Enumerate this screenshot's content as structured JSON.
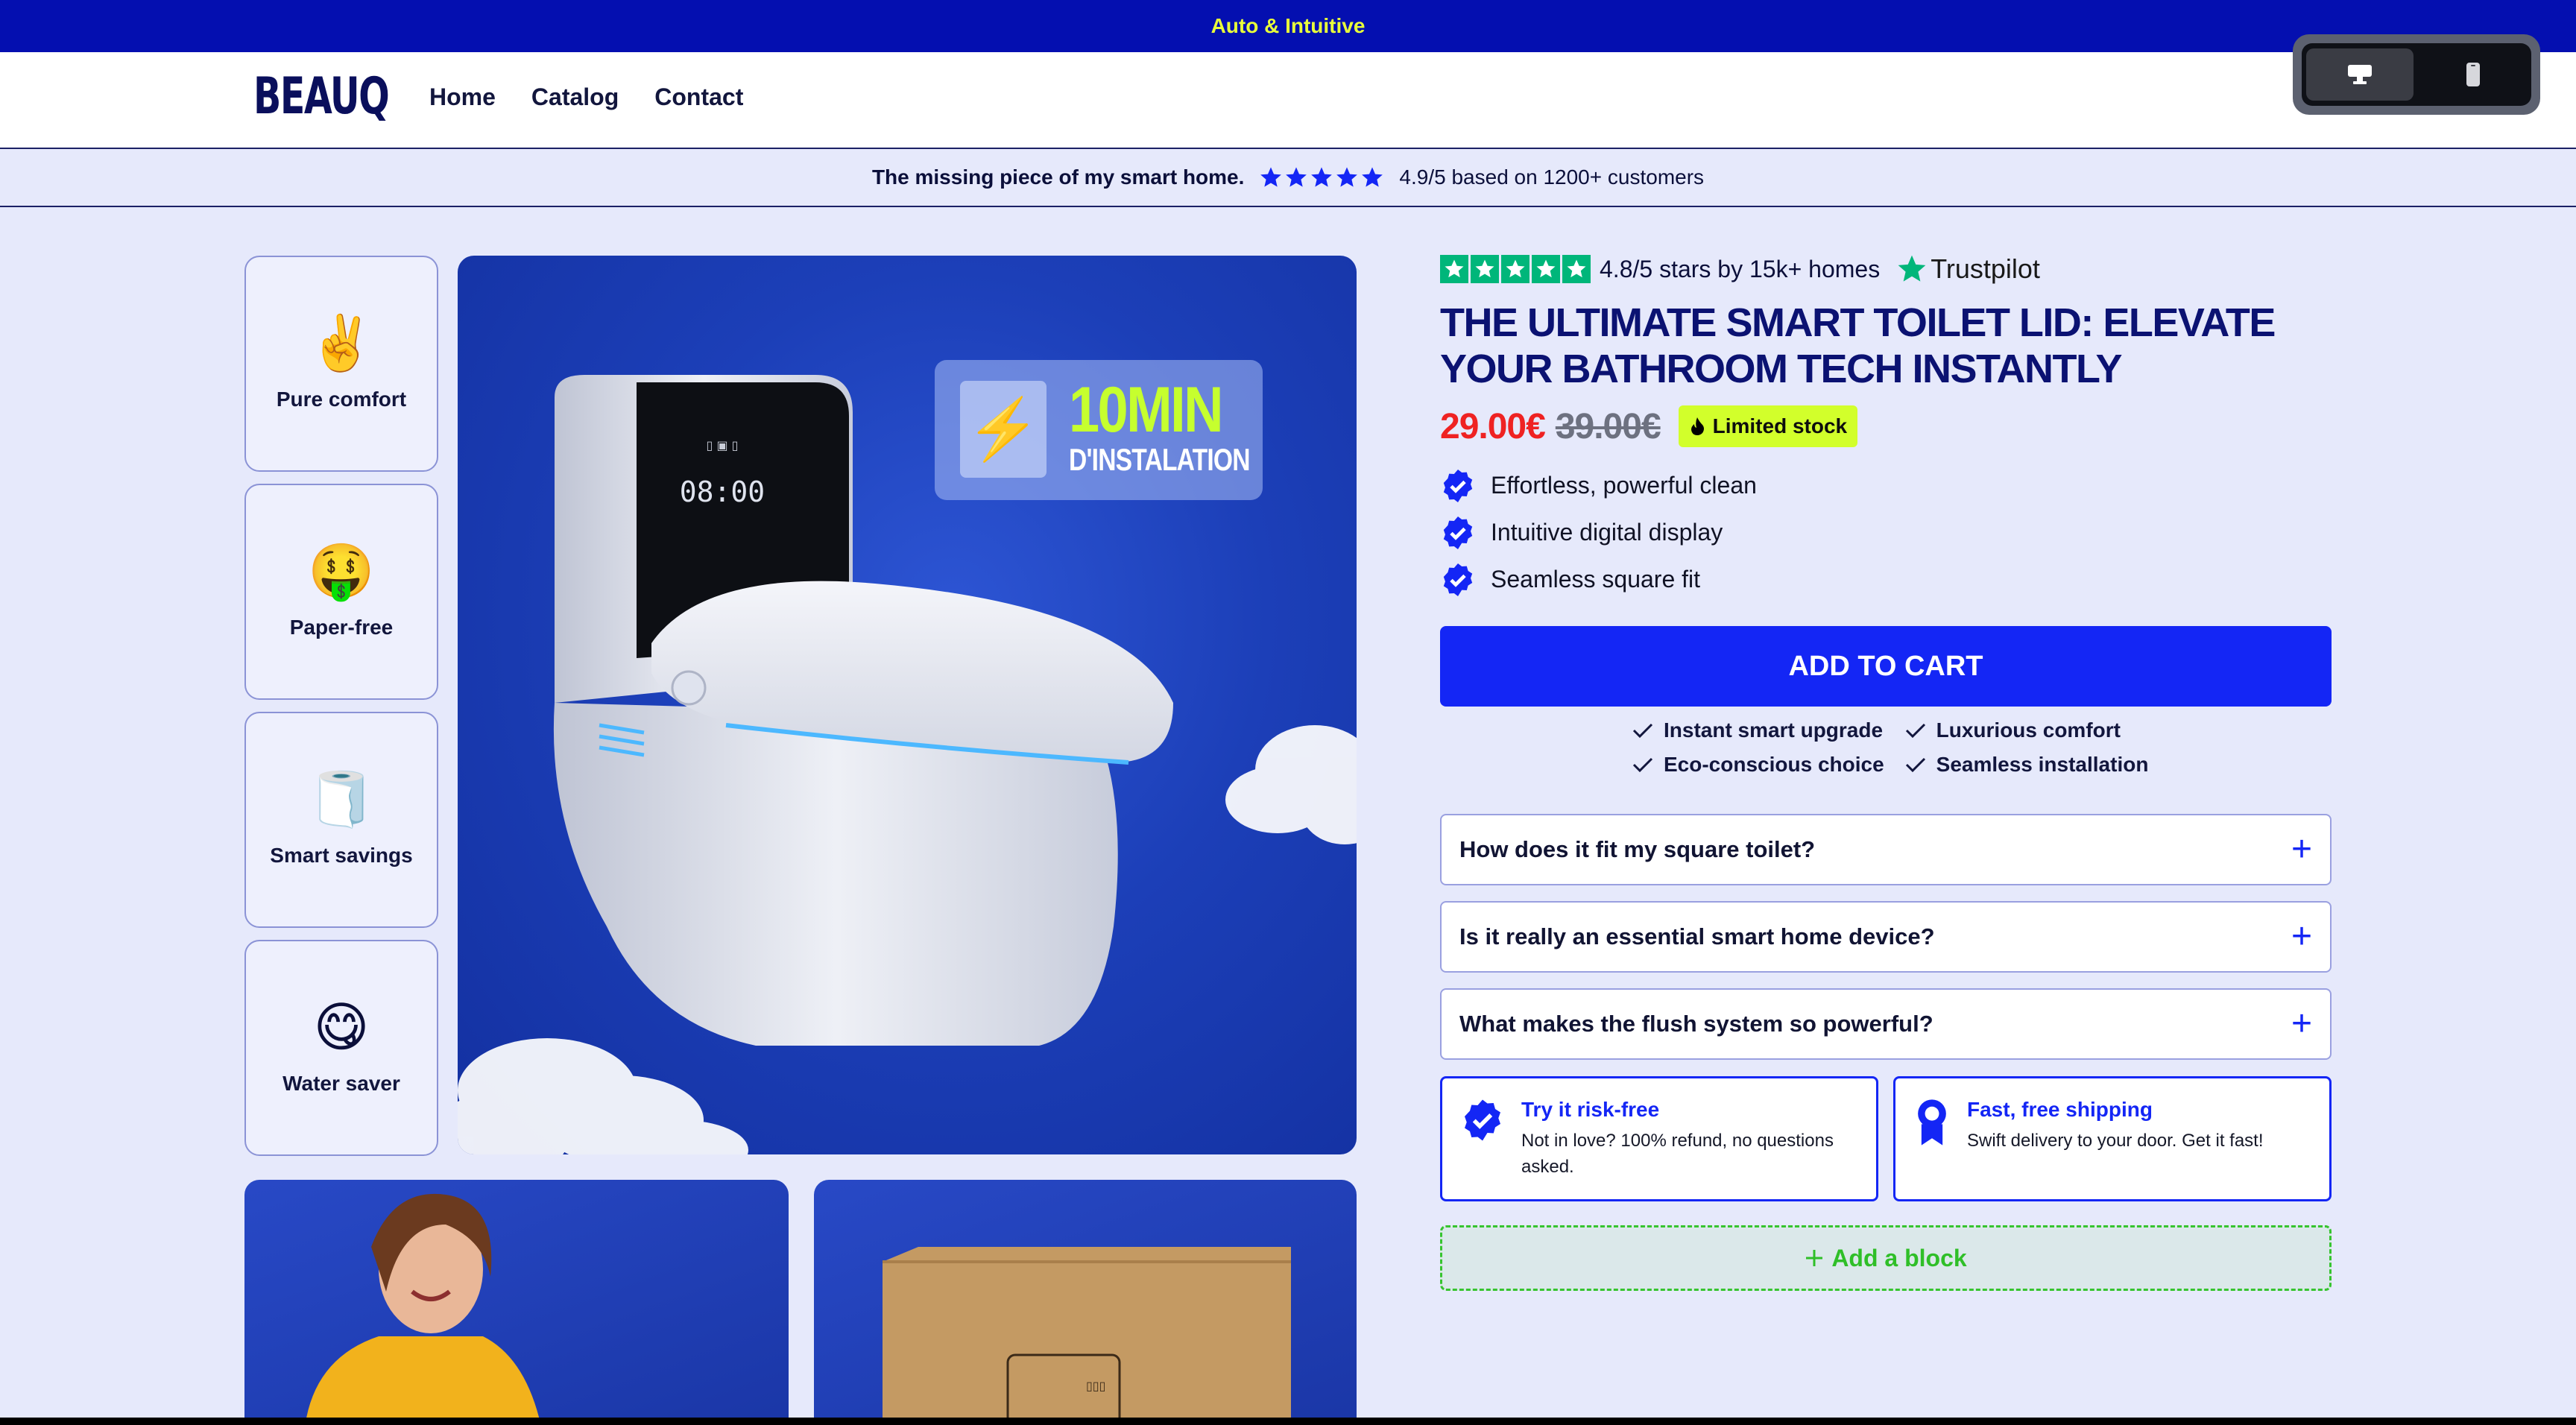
{
  "announcement": "Auto & Intuitive",
  "header": {
    "logo": "BEAUQ",
    "nav": [
      "Home",
      "Catalog",
      "Contact"
    ]
  },
  "view_toggle": {
    "options": [
      "desktop-icon",
      "mobile-icon"
    ],
    "active": "desktop"
  },
  "trust_bar": {
    "tagline": "The missing piece of my smart home.",
    "rating_text": "4.9/5 based on 1200+ customers",
    "stars": 5
  },
  "thumbnails": [
    {
      "emoji": "✌️",
      "label": "Pure comfort"
    },
    {
      "emoji": "🤑",
      "label": "Paper-free"
    },
    {
      "emoji": "🧻",
      "label": "Smart savings"
    },
    {
      "emoji": "😋",
      "label": "Water saver"
    }
  ],
  "main_image": {
    "badge_top": "10MIN",
    "badge_bottom": "D'INSTALATION",
    "display_time": "08:00"
  },
  "product": {
    "trustpilot_text": "4.8/5 stars by 15k+ homes",
    "trustpilot_brand": "Trustpilot",
    "title": "THE ULTIMATE SMART TOILET LID: ELEVATE YOUR BATHROOM TECH INSTANTLY",
    "price": "29.00€",
    "compare_price": "39.00€",
    "stock_badge": "Limited stock",
    "features": [
      "Effortless, powerful clean",
      "Intuitive digital display",
      "Seamless square fit"
    ],
    "add_to_cart": "ADD TO CART",
    "checks": [
      "Instant smart upgrade",
      "Luxurious comfort",
      "Eco-conscious choice",
      "Seamless installation"
    ],
    "faqs": [
      "How does it fit my square toilet?",
      "Is it really an essential smart home device?",
      "What makes the flush system so powerful?"
    ],
    "cards": [
      {
        "icon": "verified-badge-icon",
        "title": "Try it risk-free",
        "desc": "Not in love? 100% refund, no questions asked."
      },
      {
        "icon": "award-ribbon-icon",
        "title": "Fast, free shipping",
        "desc": "Swift delivery to your door. Get it fast!"
      }
    ],
    "add_block": "Add a block"
  },
  "colors": {
    "accent": "#1426f5",
    "announcement_bg": "#040fb0",
    "announcement_text": "#e9ff3a",
    "page_bg": "#e6e9fb",
    "price": "#ef2222",
    "stock_badge": "#d2ff2b",
    "trustpilot_green": "#00b67a"
  }
}
